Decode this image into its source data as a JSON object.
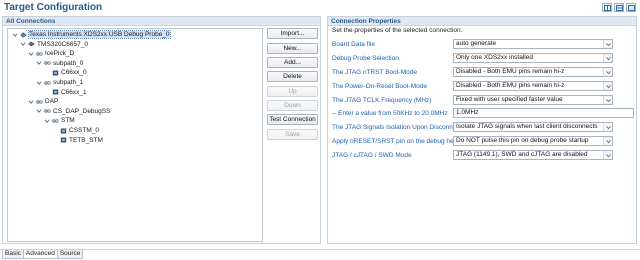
{
  "window": {
    "title": "Target Configuration"
  },
  "connections_panel": {
    "header": "All Connections",
    "tree": [
      {
        "label": "Texas Instruments XDS2xx USB Debug Probe_0",
        "level": 0,
        "expanded": true,
        "icon": "probe-icon",
        "selected": true
      },
      {
        "label": "TMS320C6657_0",
        "level": 1,
        "expanded": true,
        "icon": "device-icon"
      },
      {
        "label": "IcePick_D",
        "level": 2,
        "expanded": true,
        "icon": "router-icon"
      },
      {
        "label": "subpath_0",
        "level": 3,
        "expanded": true,
        "icon": "router-icon"
      },
      {
        "label": "C66xx_0",
        "level": 4,
        "expanded": false,
        "icon": "cpu-icon"
      },
      {
        "label": "subpath_1",
        "level": 3,
        "expanded": true,
        "icon": "router-icon"
      },
      {
        "label": "C66xx_1",
        "level": 4,
        "expanded": false,
        "icon": "cpu-icon"
      },
      {
        "label": "DAP",
        "level": 2,
        "expanded": true,
        "icon": "router-icon"
      },
      {
        "label": "CS_DAP_DebugSS",
        "level": 3,
        "expanded": true,
        "icon": "router-icon"
      },
      {
        "label": "STM",
        "level": 4,
        "expanded": true,
        "icon": "router-icon"
      },
      {
        "label": "CSSTM_0",
        "level": 5,
        "expanded": false,
        "icon": "cpu-icon"
      },
      {
        "label": "TETB_STM",
        "level": 5,
        "expanded": false,
        "icon": "cpu-icon"
      }
    ],
    "buttons": [
      {
        "label": "Import...",
        "enabled": true
      },
      {
        "label": "New...",
        "enabled": true
      },
      {
        "label": "Add...",
        "enabled": true
      },
      {
        "label": "Delete",
        "enabled": true
      },
      {
        "label": "Up",
        "enabled": false
      },
      {
        "label": "Down",
        "enabled": false
      },
      {
        "label": "Test Connection",
        "enabled": true
      },
      {
        "label": "Save",
        "enabled": false
      }
    ]
  },
  "properties_panel": {
    "header": "Connection Properties",
    "description": "Set the properties of the selected connection.",
    "rows": [
      {
        "label": "Board Data file",
        "type": "select",
        "value": "auto generate"
      },
      {
        "label": "Debug Probe Selection",
        "type": "select",
        "value": "Only one XDS2xx installed"
      },
      {
        "label": "The JTAG nTRST Boot-Mode",
        "type": "select",
        "value": "Disabled - Both EMU pins remain hi-z"
      },
      {
        "label": "The Power-On-Reset Boot-Mode",
        "type": "select",
        "value": "Disabled - Both EMU pins remain hi-z"
      },
      {
        "label": "The JTAG TCLK Frequency (MHz)",
        "type": "select",
        "value": "Fixed with user specified faster value"
      },
      {
        "label": "-- Enter a value from 50KHz to 20.0MHz",
        "type": "input",
        "value": "1.0MHz"
      },
      {
        "label": "The JTAG Signals Isolation Upon Disconnect",
        "type": "select",
        "value": "Isolate JTAG signals when last client disconnects"
      },
      {
        "label": "Apply nRESET/SRST pin on the debug header",
        "type": "select",
        "value": "Do NOT pulse this pin on debug probe startup"
      },
      {
        "label": "JTAG / cJTAG / SWD Mode",
        "type": "select",
        "value": "JTAG (1149.1), SWD and cJTAG are disabled"
      }
    ]
  },
  "tabs": [
    {
      "label": "Basic",
      "active": false
    },
    {
      "label": "Advanced",
      "active": true
    },
    {
      "label": "Source",
      "active": false
    }
  ]
}
